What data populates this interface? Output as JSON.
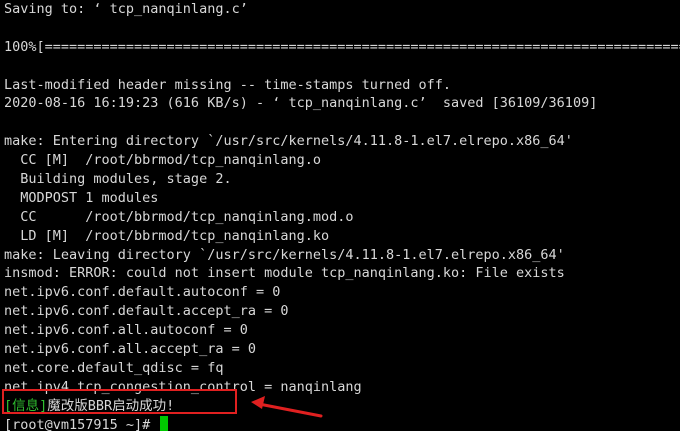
{
  "terminal": {
    "lines": [
      "Saving to: ‘ tcp_nanqinlang.c’",
      "",
      "100%[===================================================================================>]",
      "",
      "Last-modified header missing -- time-stamps turned off.",
      "2020-08-16 16:19:23 (616 KB/s) - ‘ tcp_nanqinlang.c’  saved [36109/36109]",
      "",
      "make: Entering directory `/usr/src/kernels/4.11.8-1.el7.elrepo.x86_64'",
      "  CC [M]  /root/bbrmod/tcp_nanqinlang.o",
      "  Building modules, stage 2.",
      "  MODPOST 1 modules",
      "  CC      /root/bbrmod/tcp_nanqinlang.mod.o",
      "  LD [M]  /root/bbrmod/tcp_nanqinlang.ko",
      "make: Leaving directory `/usr/src/kernels/4.11.8-1.el7.elrepo.x86_64'",
      "insmod: ERROR: could not insert module tcp_nanqinlang.ko: File exists",
      "net.ipv6.conf.default.autoconf = 0",
      "net.ipv6.conf.default.accept_ra = 0",
      "net.ipv6.conf.all.autoconf = 0",
      "net.ipv6.conf.all.accept_ra = 0",
      "net.core.default_qdisc = fq",
      "net.ipv4.tcp_congestion_control = nanqinlang"
    ],
    "info_tag": "[信息]",
    "info_message": "魔改版BBR启动成功!",
    "prompt": "[root@vm157915 ~]# "
  },
  "colors": {
    "background": "#000000",
    "text": "#d8d8d8",
    "info_tag": "#2fbf2f",
    "cursor": "#00c800",
    "annotation": "#e02020"
  }
}
